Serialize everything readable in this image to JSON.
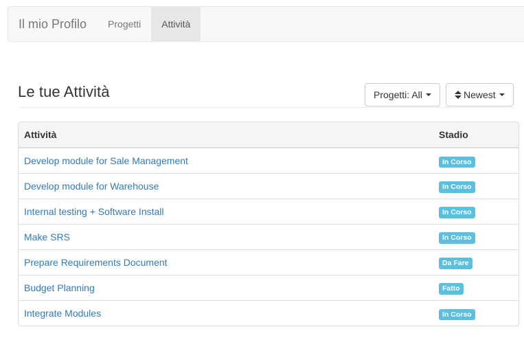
{
  "navbar": {
    "brand": "Il mio Profilo",
    "items": [
      {
        "label": "Progetti",
        "active": false
      },
      {
        "label": "Attività",
        "active": true
      }
    ]
  },
  "page": {
    "title": "Le tue Attività",
    "filter_button": "Progetti: All",
    "sort_button": "Newest",
    "icons": {
      "filter_caret": "caret-down-icon",
      "sort": "sort-icon",
      "sort_caret": "caret-down-icon"
    }
  },
  "table": {
    "columns": [
      "Attività",
      "Stadio"
    ],
    "rows": [
      {
        "task": "Develop module for Sale Management",
        "stage": "In Corso"
      },
      {
        "task": "Develop module for Warehouse",
        "stage": "In Corso"
      },
      {
        "task": "Internal testing + Software Install",
        "stage": "In Corso"
      },
      {
        "task": "Make SRS",
        "stage": "In Corso"
      },
      {
        "task": "Prepare Requirements Document",
        "stage": "Da Fare"
      },
      {
        "task": "Budget Planning",
        "stage": "Fatto"
      },
      {
        "task": "Integrate Modules",
        "stage": "In Corso"
      }
    ]
  },
  "colors": {
    "badge": "#5bc0de",
    "link": "#337ab7",
    "navbar_bg": "#f8f8f8",
    "navbar_active": "#e7e7e7"
  }
}
